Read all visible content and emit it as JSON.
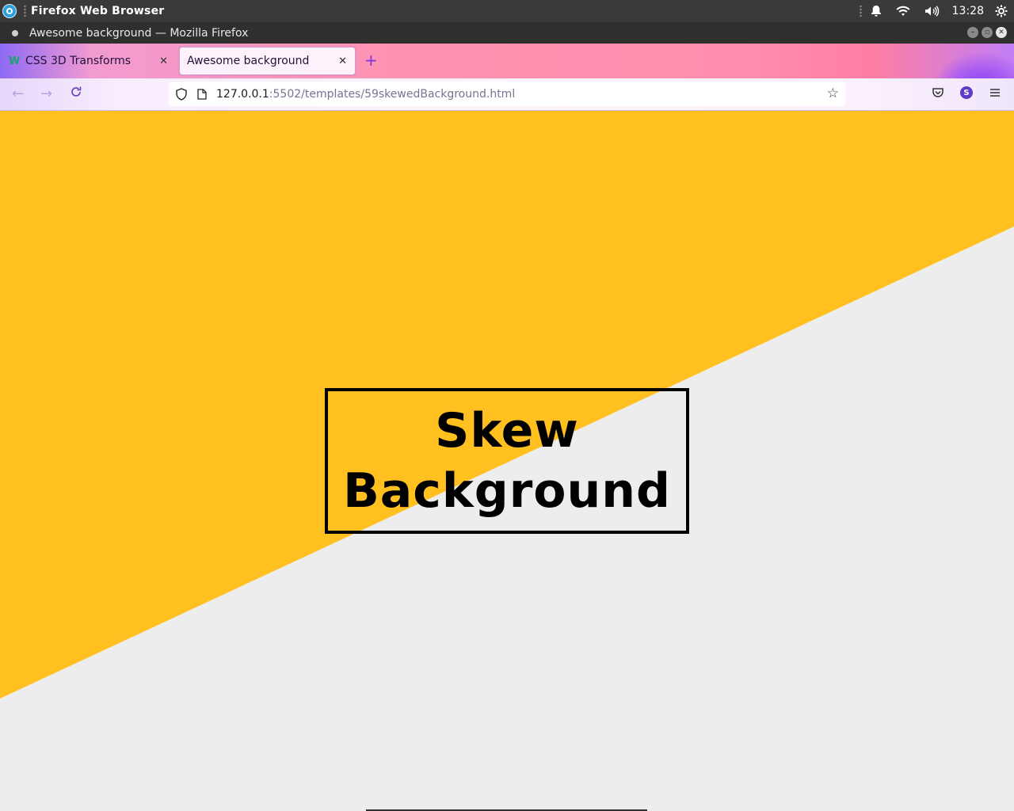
{
  "os_bar": {
    "app_name": "Firefox Web Browser",
    "time": "13:28",
    "icons": [
      "app-menu-icon",
      "notification-bell-icon",
      "wifi-icon",
      "volume-icon",
      "settings-gear-icon"
    ]
  },
  "window": {
    "title": "Awesome background — Mozilla Firefox"
  },
  "tabs": [
    {
      "label": "CSS 3D Transforms",
      "active": false,
      "favicon": "W"
    },
    {
      "label": "Awesome background",
      "active": true
    }
  ],
  "nav": {
    "url_host": "127.0.0.1",
    "url_path": ":5502/templates/59skewedBackground.html",
    "account_initial": "S"
  },
  "page": {
    "heading_line1": "Skew",
    "heading_line2": "Background"
  },
  "colors": {
    "accent": "#ffc020",
    "page_background": "#ededed",
    "heading_border": "#000000"
  }
}
